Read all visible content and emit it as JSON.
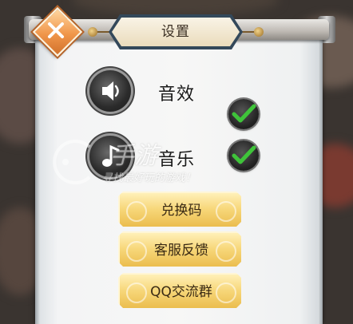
{
  "dialog": {
    "title": "设置"
  },
  "settings": [
    {
      "label": "音效",
      "icon": "speaker-icon",
      "checked": true
    },
    {
      "label": "音乐",
      "icon": "music-note-icon",
      "checked": true
    }
  ],
  "buttons": [
    {
      "label": "兑换码"
    },
    {
      "label": "客服反馈"
    },
    {
      "label": "QQ交流群"
    }
  ],
  "watermark": {
    "main": "手游",
    "sub": "寻找最好玩的游戏！"
  },
  "colors": {
    "check_green": "#3fc43a",
    "button_gold": "#f7d77a",
    "close_orange": "#f0964a",
    "title_border": "#33485a"
  }
}
